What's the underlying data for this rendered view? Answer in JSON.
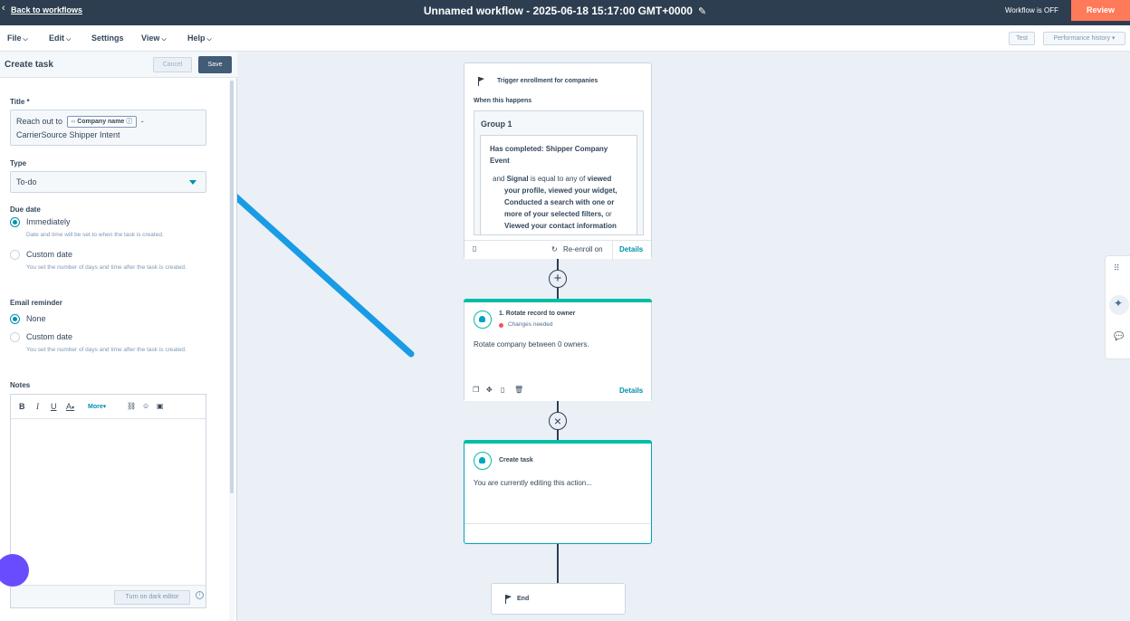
{
  "topbar": {
    "back_label": "Back to workflows",
    "workflow_title": "Unnamed workflow - 2025-06-18 15:17:00 GMT+0000",
    "status": "Workflow is OFF",
    "review_label": "Review"
  },
  "menubar": {
    "items": [
      "File",
      "Edit",
      "Settings",
      "View",
      "Help"
    ],
    "test_label": "Test",
    "performance_label": "Performance history"
  },
  "panel": {
    "title": "Create task",
    "cancel_label": "Cancel",
    "save_label": "Save",
    "title_label": "Title *",
    "title_prefix": "Reach out to",
    "title_token": "Company name",
    "title_suffix_dash": "-",
    "title_suffix": "CarrierSource Shipper Intent",
    "type_label": "Type",
    "type_value": "To-do",
    "due_label": "Due date",
    "due_opt1": "Immediately",
    "due_opt1_help": "Date and time will be set to when the task is created.",
    "due_opt2": "Custom date",
    "due_opt2_help": "You set the number of days and time after the task is created.",
    "reminder_label": "Email reminder",
    "rem_opt1": "None",
    "rem_opt2": "Custom date",
    "rem_opt2_help": "You set the number of days and time after the task is created.",
    "notes_label": "Notes",
    "toolbar": {
      "bold": "B",
      "italic": "I",
      "underline": "U",
      "color": "A",
      "more": "More"
    },
    "dark_editor_label": "Turn on dark editor"
  },
  "canvas": {
    "trigger": {
      "title": "Trigger enrollment for companies",
      "when": "When this happens",
      "group": "Group 1",
      "line1": "Has completed: Shipper Company Event",
      "and": "and",
      "signal": "Signal",
      "is_equal": "is equal to any of",
      "values": "viewed your profile, viewed your widget, Conducted a search with one or more of your selected filters,",
      "or": "or",
      "last_value": "Viewed your contact information",
      "reenroll": "Re-enroll on",
      "details": "Details"
    },
    "rotate": {
      "title": "1. Rotate record to owner",
      "status": "Changes needed",
      "text": "Rotate company between 0 owners.",
      "details": "Details"
    },
    "create": {
      "title": "Create task",
      "text": "You are currently editing this action..."
    },
    "end": {
      "label": "End"
    }
  }
}
